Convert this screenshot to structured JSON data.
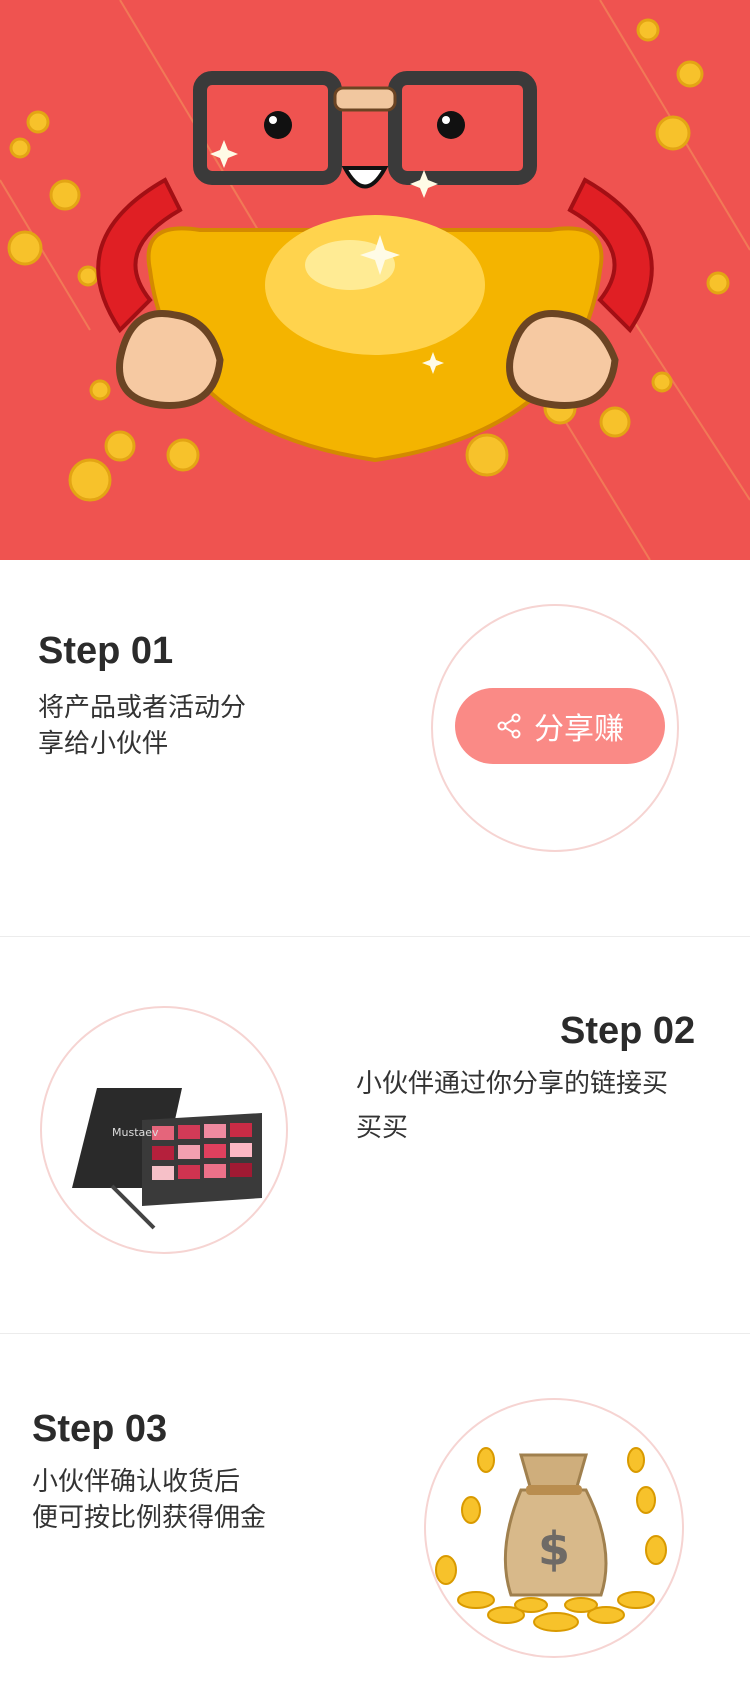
{
  "hero": {
    "background": "#ef5350",
    "icon": "cartoon-gold-ingot-mascot"
  },
  "steps": [
    {
      "title": "Step 01",
      "desc_line1": "将产品或者活动分",
      "desc_line2": "享给小伙伴"
    },
    {
      "title": "Step 02",
      "desc_line1": "小伙伴通过你分享的链接买",
      "desc_line2": "买买"
    },
    {
      "title": "Step 03",
      "desc_line1": "小伙伴确认收货后",
      "desc_line2": "便可按比例获得佣金"
    }
  ],
  "share_button": {
    "label": "分享赚",
    "icon": "share-icon",
    "color": "#fa8a86"
  },
  "palette": {
    "brand_red": "#ef5350",
    "circle_border": "#f6d4d2",
    "gold": "#f7c22b"
  }
}
